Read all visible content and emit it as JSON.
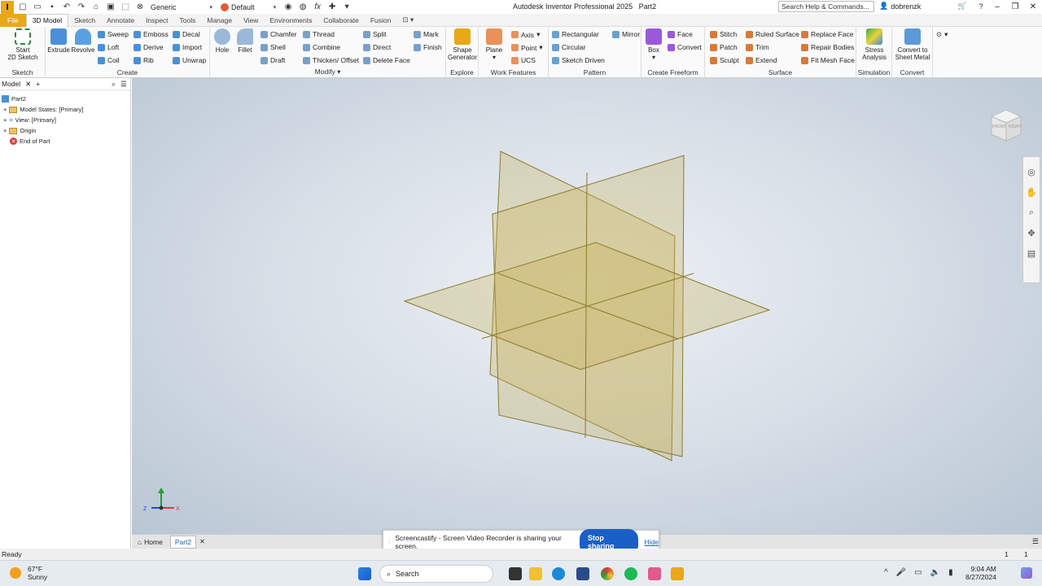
{
  "app": {
    "logo": "I",
    "title": "Autodesk Inventor Professional 2025",
    "doc": "Part2",
    "search_help": "Search Help & Commands...",
    "user": "dobrenzk",
    "material": "Generic",
    "appearance": "Default"
  },
  "tabs": [
    "File",
    "3D Model",
    "Sketch",
    "Annotate",
    "Inspect",
    "Tools",
    "Manage",
    "View",
    "Environments",
    "Collaborate",
    "Fusion"
  ],
  "ribbon": {
    "sketch": {
      "start": "Start",
      "start2": "2D Sketch",
      "panel": "Sketch"
    },
    "create": {
      "extrude": "Extrude",
      "revolve": "Revolve",
      "sweep": "Sweep",
      "loft": "Loft",
      "coil": "Coil",
      "emboss": "Emboss",
      "derive": "Derive",
      "rib": "Rib",
      "decal": "Decal",
      "import": "Import",
      "unwrap": "Unwrap",
      "panel": "Create"
    },
    "modify": {
      "hole": "Hole",
      "fillet": "Fillet",
      "chamfer": "Chamfer",
      "shell": "Shell",
      "draft": "Draft",
      "thread": "Thread",
      "combine": "Combine",
      "thicken": "Thicken/ Offset",
      "split": "Split",
      "direct": "Direct",
      "delete_face": "Delete Face",
      "mark": "Mark",
      "finish": "Finish",
      "panel": "Modify"
    },
    "explore": {
      "shape1": "Shape",
      "shape2": "Generator",
      "panel": "Explore"
    },
    "work": {
      "plane": "Plane",
      "axis": "Axis",
      "point": "Point",
      "ucs": "UCS",
      "panel": "Work Features"
    },
    "pattern": {
      "rect": "Rectangular",
      "circ": "Circular",
      "sketch": "Sketch Driven",
      "mirror": "Mirror",
      "panel": "Pattern"
    },
    "freeform": {
      "box": "Box",
      "face": "Face",
      "convert": "Convert",
      "panel": "Create Freeform"
    },
    "surface": {
      "stitch": "Stitch",
      "patch": "Patch",
      "sculpt": "Sculpt",
      "ruled": "Ruled Surface",
      "trim": "Trim",
      "extend": "Extend",
      "replace": "Replace Face",
      "repair": "Repair Bodies",
      "fitmesh": "Fit Mesh Face",
      "panel": "Surface"
    },
    "sim": {
      "stress1": "Stress",
      "stress2": "Analysis",
      "panel": "Simulation"
    },
    "conv": {
      "c1": "Convert to",
      "c2": "Sheet Metal",
      "panel": "Convert"
    }
  },
  "browser": {
    "tab": "Model",
    "items": [
      "Part2",
      "Model States: [Primary]",
      "View: [Primary]",
      "Origin",
      "End of Part"
    ]
  },
  "viewcube": {
    "front": "FRONT",
    "right": "RIGHT"
  },
  "doctabs": [
    "Home",
    "Part2"
  ],
  "status": {
    "text": "Ready",
    "n1": "1",
    "n2": "1"
  },
  "share": {
    "msg": "Screencastify - Screen Video Recorder is sharing your screen.",
    "stop": "Stop sharing",
    "hide": "Hide"
  },
  "taskbar": {
    "temp": "67°F",
    "weather": "Sunny",
    "search": "Search",
    "time": "9:04 AM",
    "date": "8/27/2024"
  },
  "colors": {
    "accent": "#e8a817",
    "plane_fill": "#c8b25a",
    "plane_stroke": "#8a7a2a",
    "share_btn": "#1a5fc7"
  }
}
